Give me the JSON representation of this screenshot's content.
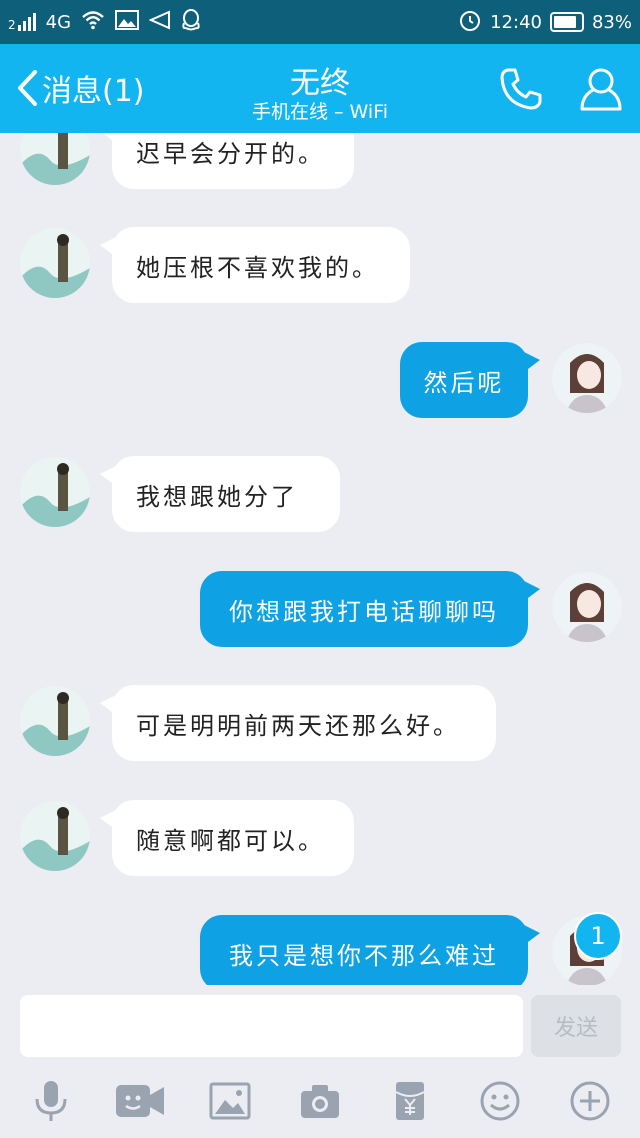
{
  "status_bar": {
    "sim": "2",
    "network": "4G",
    "time": "12:40",
    "battery": "83%"
  },
  "header": {
    "back_label": "消息(1)",
    "title": "无终",
    "subtitle": "手机在线 – WiFi",
    "icons": [
      "phone-icon",
      "profile-icon"
    ]
  },
  "messages": [
    {
      "side": "in",
      "text": "迟早会分开的。"
    },
    {
      "side": "in",
      "text": "她压根不喜欢我的。"
    },
    {
      "side": "out",
      "text": "然后呢"
    },
    {
      "side": "in",
      "text": "我想跟她分了"
    },
    {
      "side": "out",
      "text": "你想跟我打电话聊聊吗"
    },
    {
      "side": "in",
      "text": "可是明明前两天还那么好。"
    },
    {
      "side": "in",
      "text": "随意啊都可以。"
    },
    {
      "side": "out",
      "text": "我只是想你不那么难过"
    }
  ],
  "unread_count": "1",
  "composer": {
    "input_value": "",
    "send_label": "发送"
  },
  "toolbar": [
    "mic-icon",
    "video-icon",
    "image-icon",
    "camera-icon",
    "red-packet-icon",
    "emoji-icon",
    "plus-icon"
  ],
  "colors": {
    "status_bar": "#0e5f7a",
    "header": "#13b5f1",
    "outgoing_bubble": "#0ea1e3",
    "background": "#ebedf2",
    "toolbar_icon": "#9aa3b0"
  }
}
